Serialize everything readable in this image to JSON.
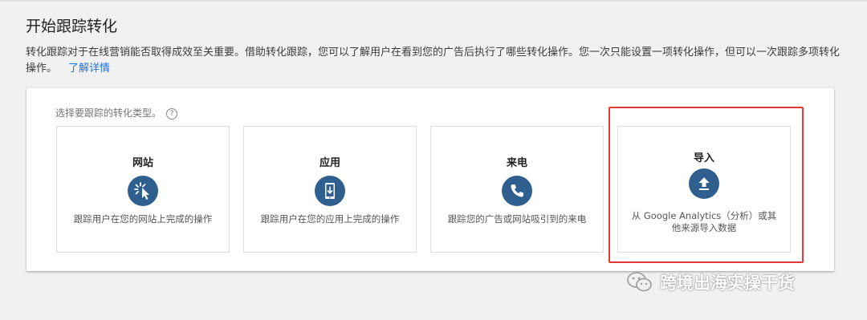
{
  "page": {
    "title": "开始跟踪转化",
    "description": "转化跟踪对于在线营销能否取得成效至关重要。借助转化跟踪，您可以了解用户在看到您的广告后执行了哪些转化操作。您一次只能设置一项转化操作，但可以一次跟踪多项转化操作。",
    "learn_more": "了解详情"
  },
  "panel": {
    "prompt": "选择要跟踪的转化类型。",
    "help_icon": "?",
    "cards": [
      {
        "label": "网站",
        "icon": "cursor-click-icon",
        "subtitle": "跟踪用户在您的网站上完成的操作"
      },
      {
        "label": "应用",
        "icon": "mobile-download-icon",
        "subtitle": "跟踪用户在您的应用上完成的操作"
      },
      {
        "label": "来电",
        "icon": "phone-icon",
        "subtitle": "跟踪您的广告或网站吸引到的来电"
      },
      {
        "label": "导入",
        "icon": "upload-icon",
        "subtitle": "从 Google Analytics（分析）或其他来源导入数据"
      }
    ]
  },
  "watermark": {
    "text": "跨境出海实操干货"
  },
  "colors": {
    "icon_bg": "#2f5f8f",
    "link": "#1a73e8",
    "highlight": "#e53935"
  }
}
